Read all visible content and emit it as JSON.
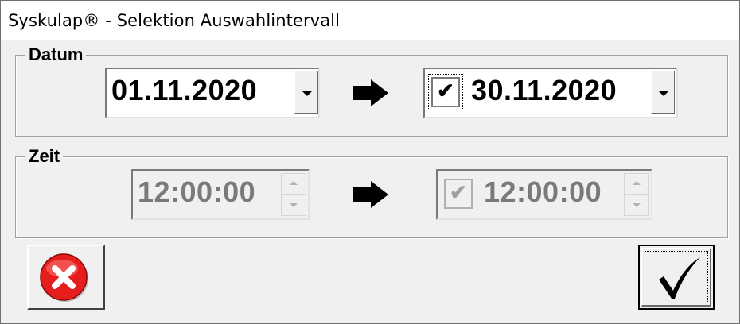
{
  "window": {
    "title": "Syskulap® - Selektion Auswahlintervall"
  },
  "datum": {
    "legend": "Datum",
    "from_date": "01.11.2020",
    "to_date": "30.11.2020",
    "to_checked": true
  },
  "zeit": {
    "legend": "Zeit",
    "from_time": "12:00:00",
    "to_time": "12:00:00",
    "to_checked": true,
    "enabled": false
  },
  "icons": {
    "range_arrow": "right-arrow-icon",
    "cancel": "cancel-icon",
    "ok": "checkmark-icon",
    "checkbox_mark": "✔"
  },
  "colors": {
    "cancel_red": "#e51d1d"
  }
}
